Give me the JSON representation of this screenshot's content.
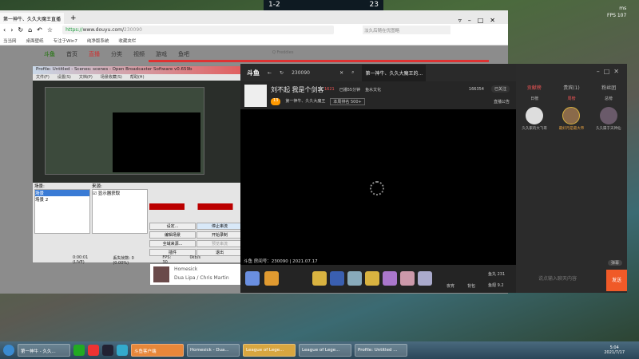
{
  "game": {
    "score": "1-2",
    "timer": "23",
    "ms": "ms",
    "fps_label": "FPS",
    "fps": "107"
  },
  "browser": {
    "tab_title": "第一神牛、久久大魔王直播",
    "url_scheme": "https://",
    "url_host": "www.douyu.com/",
    "url_path": "230090",
    "search_placeholder": "淡久后随在优图略",
    "bookmarks": [
      "当当网",
      "桌面壁纸",
      "专注于Win7",
      "纯净版系统",
      "收藏夹栏"
    ],
    "nav": [
      "首页",
      "直播",
      "分类",
      "视频",
      "游戏",
      "鱼吧"
    ],
    "search_hint": "Q Freddies"
  },
  "obs": {
    "title": "Profile: Untitled - Scenes: scenes - Open Broadcaster Software v0.659b",
    "menu": [
      "文件(F)",
      "设置(S)",
      "文档(P)",
      "场景收藏(S)",
      "帮助(H)"
    ],
    "scenes_label": "场景:",
    "scenes": [
      "场景",
      "场景 2"
    ],
    "sources_label": "来源:",
    "sources": [
      "显示器获取"
    ],
    "buttons": [
      "设定...",
      "停止串流",
      "编辑场景",
      "开始录制",
      "全域来源...",
      "预览串流",
      "插件",
      "退出"
    ],
    "status": [
      "0:00:01 (LIVE)",
      "丢失帧数: 0 (0.00%)",
      "FPS: 30",
      "0kb/s"
    ]
  },
  "music": {
    "song": "Homesick",
    "artist": "Dua Lipa / Chris Martin"
  },
  "douyu": {
    "room_input": "230090",
    "tab": "第一神牛、久久大魔王的...",
    "streamer_title": "刘不起 我是个剑客",
    "heat": "1621",
    "tag1": "已播55分钟",
    "tag2": "鱼水文化",
    "level": "13",
    "name": "第一神牛、久久大魔王",
    "rank": "本周排名 500+",
    "fans": "166354",
    "follow": "已关注",
    "notice": "直播公告",
    "footer": "斗鱼 房间号：230090 | 2021.07.17",
    "action1": "夜宵",
    "action2": "背包",
    "fish_ball_label": "鱼丸",
    "fish_ball": "231",
    "fish_fin_label": "鱼翅",
    "fish_fin": "9.2"
  },
  "side": {
    "tabs": [
      "贡献榜",
      "贵宾(1)",
      "粉丝团"
    ],
    "subtabs": [
      "日榜",
      "周榜",
      "总榜"
    ],
    "users": [
      "久久家的大飞哥",
      "最好月是最大帝",
      "久久属于天神仙"
    ],
    "chat_placeholder": "说点输入聊天内容",
    "send": "发送",
    "mode": "弹幕"
  },
  "taskbar": {
    "items": [
      "第一神牛 - 久久...",
      "斗鱼客户端",
      "Homesick - Dua...",
      "League of Lege...",
      "League of Lege...",
      "Profile: Untitled ..."
    ],
    "time": "5:04",
    "date": "2021/7/17"
  }
}
